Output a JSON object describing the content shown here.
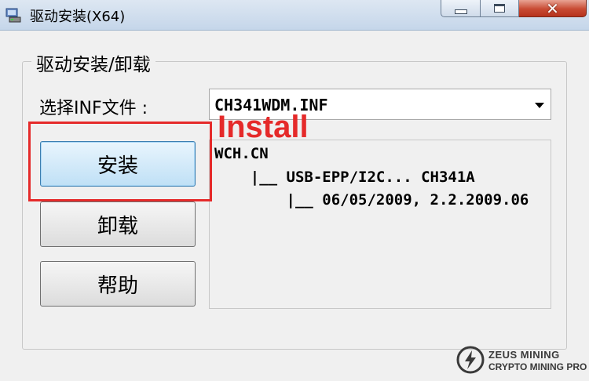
{
  "window": {
    "title": "驱动安装(X64)",
    "close_glyph": "✕"
  },
  "group": {
    "legend": "驱动安装/卸载"
  },
  "inf": {
    "label": "选择INF文件 :",
    "selected": "CH341WDM.INF"
  },
  "tree": {
    "lines": [
      "WCH.CN",
      "    |__ USB-EPP/I2C... CH341A",
      "        |__ 06/05/2009, 2.2.2009.06"
    ]
  },
  "buttons": {
    "install": "安装",
    "uninstall": "卸载",
    "help": "帮助"
  },
  "annotation": {
    "label": "Install",
    "color": "#e52a2a"
  },
  "watermark": {
    "line1": "ZEUS MINING",
    "line2": "CRYPTO MINING PRO"
  },
  "colors": {
    "accent_button": "#bfe0f6",
    "close_button": "#c84a33"
  }
}
